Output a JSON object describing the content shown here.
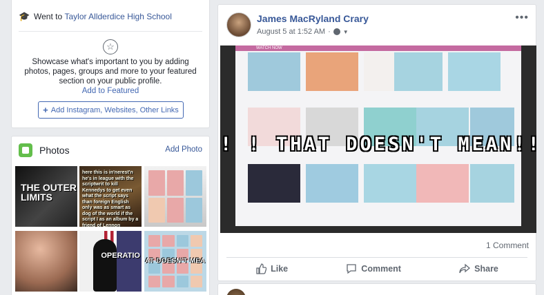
{
  "intro": {
    "school_prefix": "Went to ",
    "school_name": "Taylor Allderdice High School",
    "showcase_text": "Showcase what's important to you by adding photos, pages, groups and more to your featured section on your public profile.",
    "add_featured": "Add to Featured",
    "add_links": "Add Instagram, Websites, Other Links"
  },
  "photos": {
    "title": "Photos",
    "add_photo": "Add Photo",
    "thumbs": [
      {
        "text": "THE OUTER LIMITS"
      },
      {
        "text": "here this is in'nerest'n he's in league with the scriptwrit to kill Kennedys to get even what the script says than foreign English only was as smart as dog of the world if the script I as an album by a friend of Lennon"
      },
      {
        "text": ""
      },
      {
        "text": ""
      },
      {
        "text": "OPERATIO"
      },
      {
        "text": "AT DOESN'T MEA"
      }
    ]
  },
  "post": {
    "author": "James MacRyland Crary",
    "timestamp": "August 5 at 1:52 AM",
    "separator": "·",
    "more": "•••",
    "watch_label": "WATCH NOW",
    "meme_text": "! ! THAT DOESN'T MEAN!!!!",
    "comment_count": "1 Comment",
    "actions": {
      "like": "Like",
      "comment": "Comment",
      "share": "Share"
    }
  },
  "colors": {
    "link": "#385898",
    "accent": "#4267b2",
    "photos_icon": "#63be4b"
  }
}
